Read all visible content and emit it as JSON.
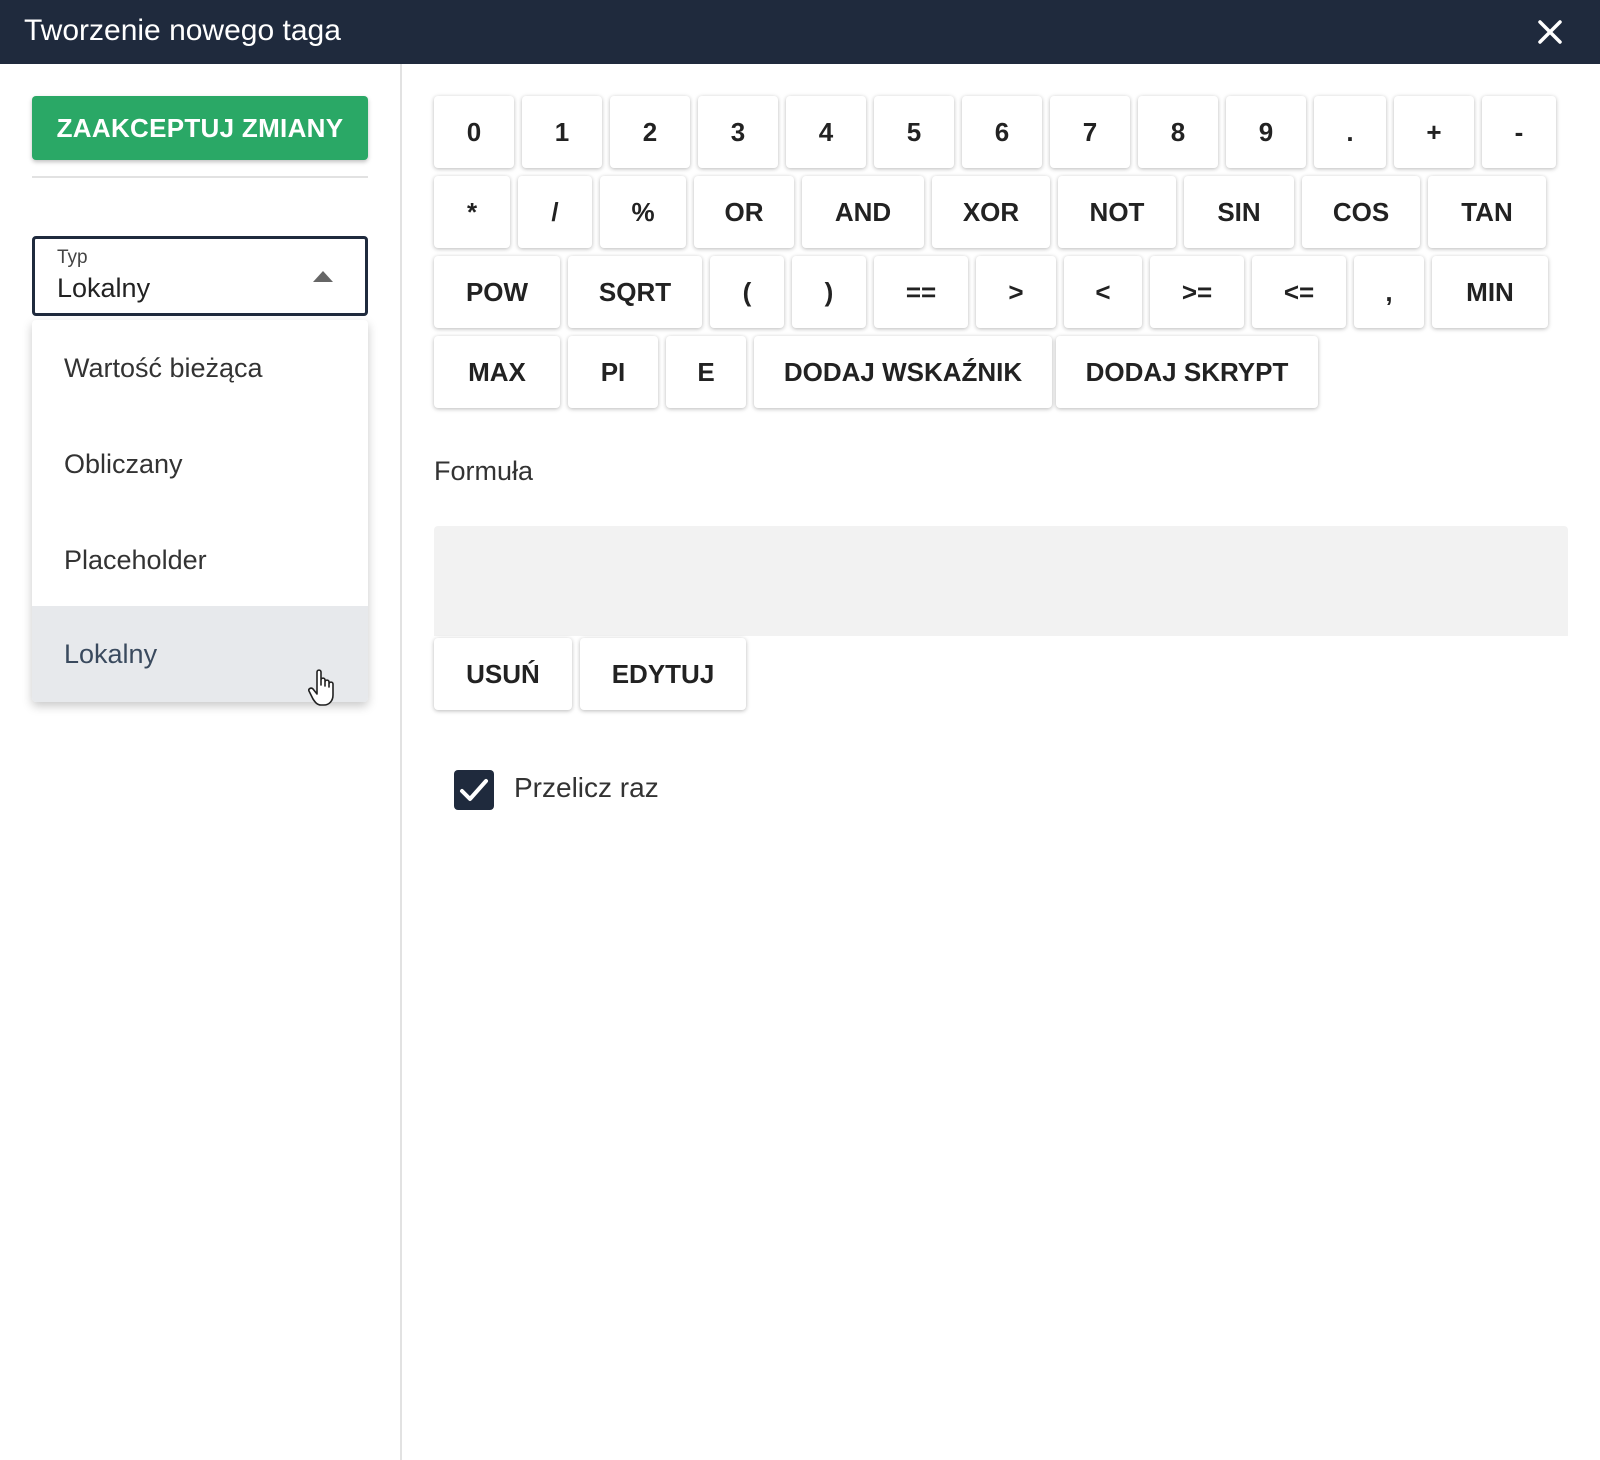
{
  "dialog": {
    "title": "Tworzenie nowego taga",
    "close_icon": "close-icon"
  },
  "sidebar": {
    "accept_label": "ZAAKCEPTUJ ZMIANY",
    "accent_color": "#2aa866",
    "type_select": {
      "label": "Typ",
      "value": "Lokalny",
      "options": [
        "Wartość bieżąca",
        "Obliczany",
        "Placeholder",
        "Lokalny"
      ],
      "selected_index": 3
    }
  },
  "keypad": {
    "row1": [
      "0",
      "1",
      "2",
      "3",
      "4",
      "5",
      "6",
      "7",
      "8",
      "9",
      ".",
      "+",
      "-"
    ],
    "row2": [
      "*",
      "/",
      "%",
      "OR",
      "AND",
      "XOR",
      "NOT",
      "SIN",
      "COS",
      "TAN"
    ],
    "row3": [
      "POW",
      "SQRT",
      "(",
      ")",
      "==",
      ">",
      "<",
      ">=",
      "<=",
      ",",
      "MIN"
    ],
    "row4": [
      "MAX",
      "PI",
      "E",
      "DODAJ WSKAŹNIK",
      "DODAJ SKRYPT"
    ]
  },
  "formula": {
    "label": "Formuła",
    "value": "",
    "delete_label": "USUŃ",
    "edit_label": "EDYTUJ"
  },
  "recalc": {
    "label": "Przelicz raz",
    "checked": true
  },
  "colors": {
    "header": "#1f2a3d",
    "accept": "#2aa866"
  }
}
